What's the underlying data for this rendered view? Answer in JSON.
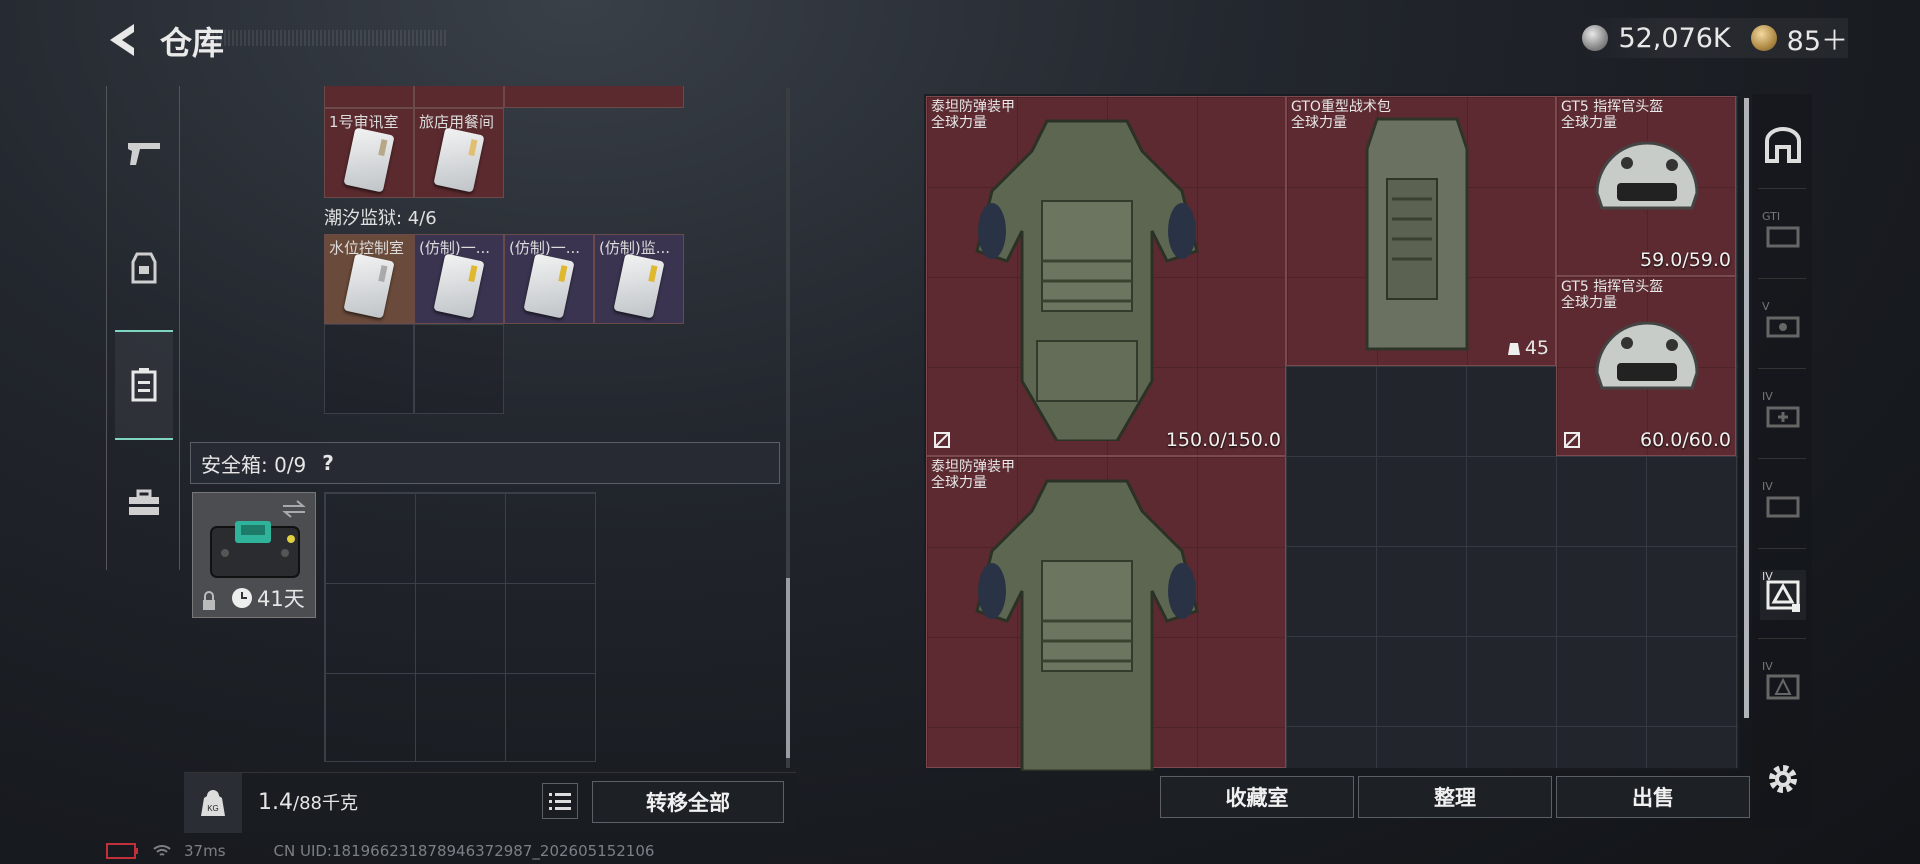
{
  "header": {
    "title": "仓库",
    "silver": "52,076K",
    "gold": "85＋"
  },
  "left": {
    "row1_labels": [
      "1号审讯室",
      "旅店用餐间"
    ],
    "section2_title": "潮汐监狱: 4/6",
    "row2_labels": [
      "水位控制室",
      "(仿制)一...",
      "(仿制)一...",
      "(仿制)监..."
    ],
    "safebox_title": "安全箱:  0/9",
    "safebox_help": "?",
    "safebox_days": "41天",
    "weight_value": "1.4",
    "weight_limit": "/88千克",
    "transfer_all": "转移全部"
  },
  "right": {
    "items": [
      {
        "name": "泰坦防弹装甲",
        "sub": "全球力量",
        "durability": "150.0/150.0"
      },
      {
        "name": "GTO重型战术包",
        "sub": "全球力量",
        "count": "45"
      },
      {
        "name": "GT5 指挥官头盔",
        "sub": "全球力量",
        "durability": "59.0/59.0"
      },
      {
        "name": "GT5 指挥官头盔",
        "sub": "全球力量",
        "durability": "60.0/60.0"
      },
      {
        "name": "泰坦防弹装甲",
        "sub": "全球力量"
      }
    ],
    "buttons": {
      "collection": "收藏室",
      "sort": "整理",
      "sell": "出售"
    }
  },
  "rightnav_labels": [
    "GTI",
    "V",
    "IV",
    "IV",
    "IV",
    "IV"
  ],
  "status": {
    "ping": "37ms",
    "uid": "CN UID:1819662318789463729​87_202605152106"
  }
}
